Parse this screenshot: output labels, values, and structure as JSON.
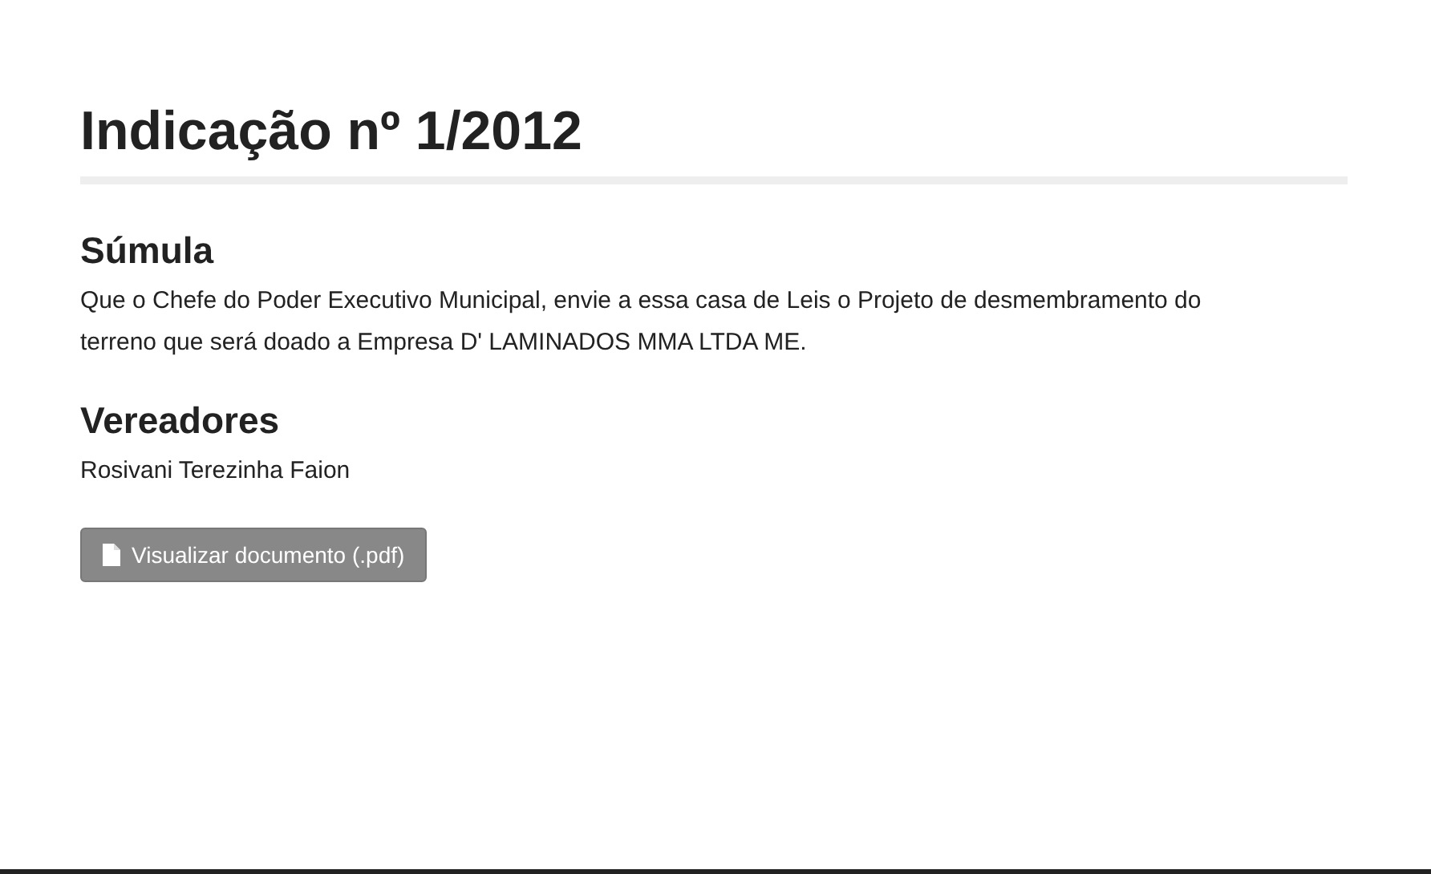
{
  "title": "Indicação nº 1/2012",
  "sections": [
    {
      "heading": "Súmula",
      "text": "Que o Chefe do Poder Executivo Municipal, envie a essa casa de Leis o Projeto de desmembramento do terreno que será doado a Empresa D' LAMINADOS MMA LTDA ME."
    },
    {
      "heading": "Vereadores",
      "text": "Rosivani Terezinha Faion"
    }
  ],
  "button": {
    "label": "Visualizar documento (.pdf)"
  }
}
